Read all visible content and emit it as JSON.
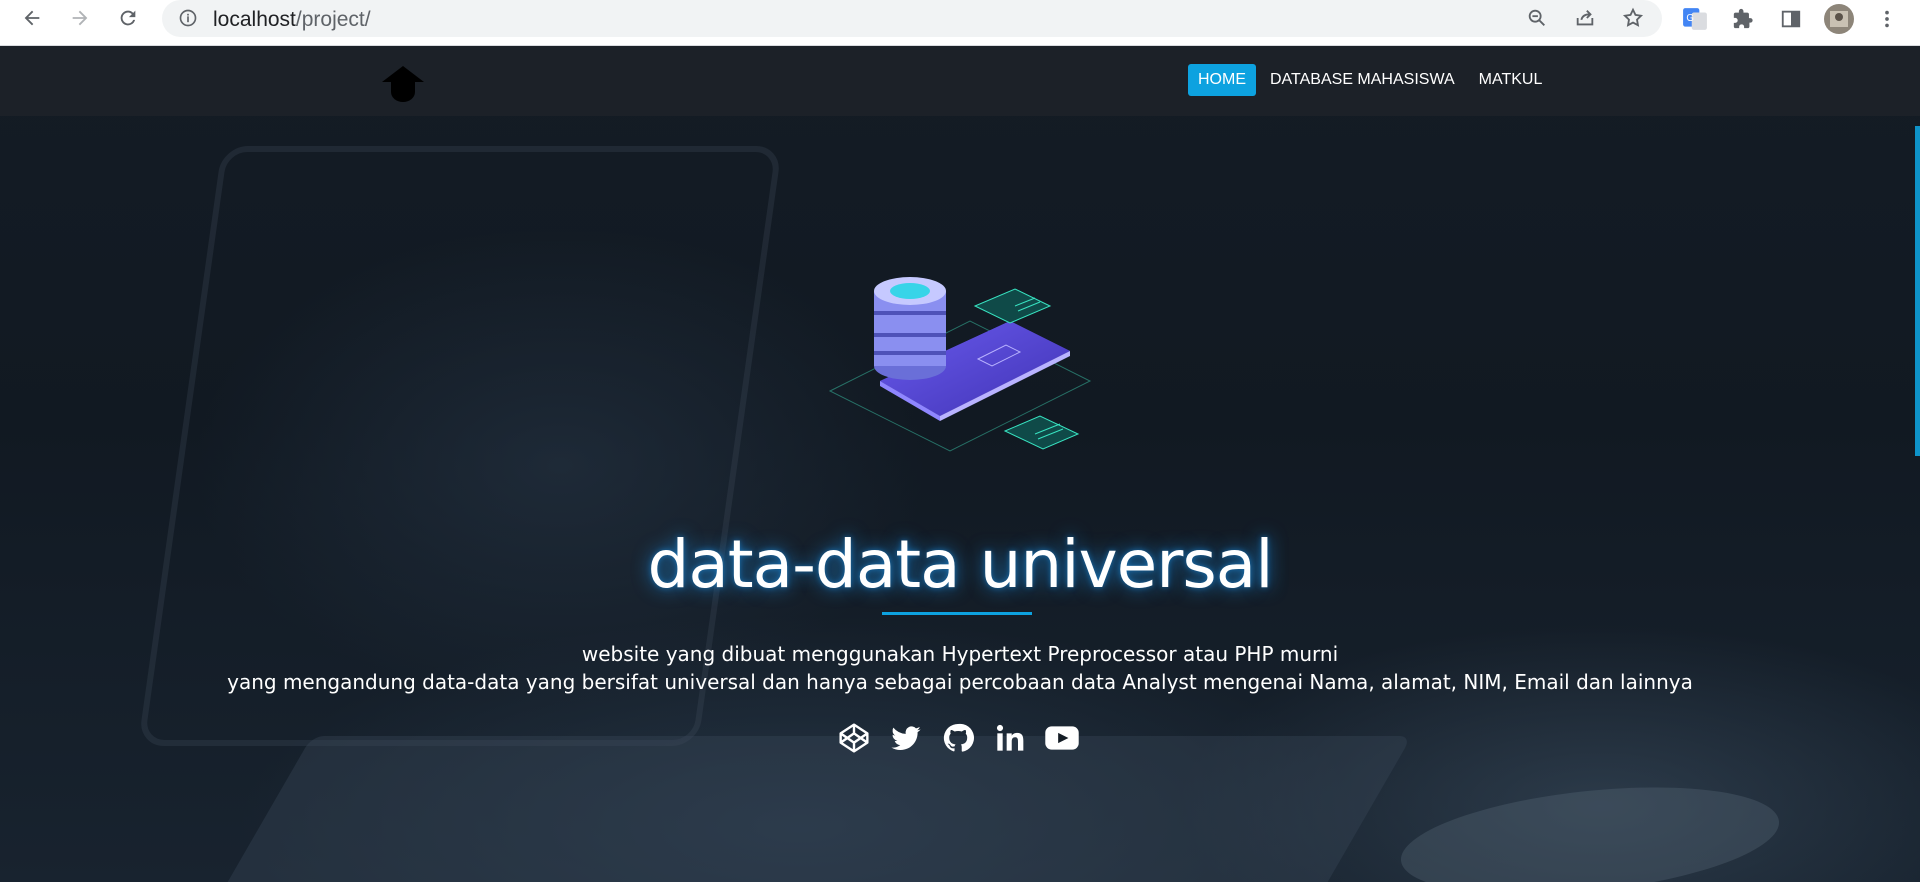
{
  "browser": {
    "url_host": "localhost",
    "url_path": "/project/"
  },
  "nav": {
    "items": [
      {
        "label": "HOME",
        "active": true
      },
      {
        "label": "DATABASE MAHASISWA",
        "active": false
      },
      {
        "label": "MATKUL",
        "active": false
      }
    ]
  },
  "hero": {
    "title": "data-data universal",
    "description_line1": "website yang dibuat menggunakan Hypertext Preprocessor atau PHP murni",
    "description_line2": "yang mengandung data-data yang bersifat universal dan hanya sebagai percobaan data Analyst mengenai Nama, alamat, NIM, Email dan lainnya"
  },
  "socials": [
    "codepen-icon",
    "twitter-icon",
    "github-icon",
    "linkedin-icon",
    "youtube-icon"
  ],
  "colors": {
    "accent": "#0da2e0",
    "navbar": "#1c2128",
    "text": "#ffffff"
  }
}
